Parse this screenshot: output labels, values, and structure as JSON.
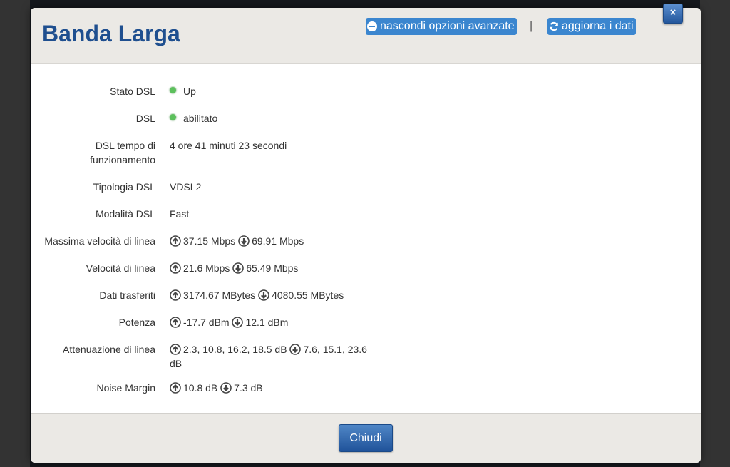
{
  "dialog": {
    "title": "Banda Larga",
    "hide_advanced_label": "nascondi opzioni avanzate",
    "separator": "|",
    "refresh_label": "aggiorna i dati",
    "close_icon_label": "×",
    "close_label": "Chiudi"
  },
  "colors": {
    "title": "#1f4f8f",
    "header_button": "#3b86cf",
    "status_led": "#5cc05c"
  },
  "rows": [
    {
      "label": "Stato DSL",
      "value": "Up",
      "status": "green"
    },
    {
      "label": "DSL",
      "value": "abilitato",
      "status": "green"
    },
    {
      "label": "DSL tempo di funzionamento",
      "value": "4 ore 41 minuti 23 secondi"
    },
    {
      "label": "Tipologia DSL",
      "value": "VDSL2"
    },
    {
      "label": "Modalità DSL",
      "value": "Fast"
    },
    {
      "label": "Massima velocità di linea",
      "up": "37.15 Mbps",
      "down": "69.91 Mbps"
    },
    {
      "label": "Velocità di linea",
      "up": "21.6 Mbps",
      "down": "65.49 Mbps"
    },
    {
      "label": "Dati trasferiti",
      "up": "3174.67 MBytes",
      "down": "4080.55 MBytes"
    },
    {
      "label": "Potenza",
      "up": "-17.7 dBm",
      "down": "12.1 dBm"
    },
    {
      "label": "Attenuazione di linea",
      "up": "2.3, 10.8, 16.2, 18.5 dB",
      "down": "7.6, 15.1, 23.6 dB"
    },
    {
      "label": "Noise Margin",
      "up": "10.8 dB",
      "down": "7.3 dB"
    }
  ],
  "icons": {
    "up": "arrow-up-circle-icon",
    "down": "arrow-down-circle-icon",
    "hide": "minus-circle-icon",
    "refresh": "refresh-icon"
  }
}
